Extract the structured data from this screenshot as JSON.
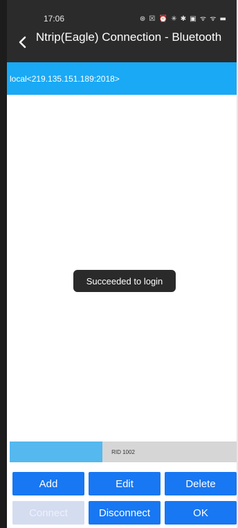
{
  "status_bar": {
    "time": "17:06",
    "icons_text": "⊛ ☒ ⏰ ✳ ✱ ▣ ᯤ ᯤ ▬"
  },
  "header": {
    "title": "Ntrip(Eagle) Connection - Bluetooth"
  },
  "source": {
    "label": "local<219.135.151.189:2018>"
  },
  "toast": {
    "message": "Succeeded to login"
  },
  "progress": {
    "label": "RID 1002",
    "fraction": 0.41
  },
  "buttons": {
    "add": "Add",
    "edit": "Edit",
    "delete": "Delete",
    "connect": "Connect",
    "disconnect": "Disconnect",
    "ok": "OK"
  },
  "colors": {
    "header_bg": "#2b2b2b",
    "selected_row": "#1aa9f5",
    "button": "#1877f2",
    "button_disabled": "#d4dcf0",
    "progress_fill": "#55b8ee",
    "progress_track": "#d6d6d6"
  },
  "icons": {
    "back": "back-arrow-icon"
  }
}
